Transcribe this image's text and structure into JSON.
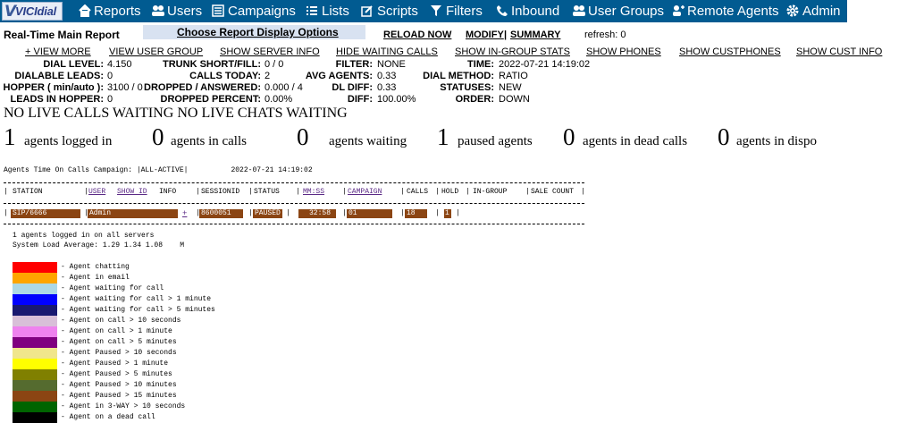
{
  "nav": {
    "logo": "VICIdial",
    "items": [
      "Reports",
      "Users",
      "Campaigns",
      "Lists",
      "Scripts",
      "Filters",
      "Inbound",
      "User Groups",
      "Remote Agents",
      "Admin"
    ],
    "bg_color": "#015b91"
  },
  "header": {
    "title": "Real-Time Main Report",
    "choose_options": "Choose Report Display Options",
    "reload": "RELOAD NOW",
    "modify": "MODIFY",
    "sep": "|",
    "summary": "SUMMARY",
    "refresh": "refresh: 0"
  },
  "view_links": [
    "+ VIEW MORE",
    "VIEW USER GROUP",
    "SHOW SERVER INFO",
    "HIDE WAITING CALLS",
    "SHOW IN-GROUP STATS",
    "SHOW PHONES",
    "SHOW CUSTPHONES",
    "SHOW CUST INFO"
  ],
  "stats": {
    "col1": [
      {
        "label": "DIAL LEVEL:",
        "value": "4.150"
      },
      {
        "label": "DIALABLE LEADS:",
        "value": "0"
      },
      {
        "label": "HOPPER ( min/auto ):",
        "value": "3100 / 0"
      },
      {
        "label": "LEADS IN HOPPER:",
        "value": "0"
      }
    ],
    "col2": [
      {
        "label": "TRUNK SHORT/FILL:",
        "value": "0 / 0"
      },
      {
        "label": "CALLS TODAY:",
        "value": "2"
      },
      {
        "label": "DROPPED / ANSWERED:",
        "value": "0.000 / 4"
      },
      {
        "label": "DROPPED PERCENT:",
        "value": "0.00%"
      }
    ],
    "col3": [
      {
        "label": "FILTER:",
        "value": "NONE"
      },
      {
        "label": "AVG AGENTS:",
        "value": "0.33"
      },
      {
        "label": "DL DIFF:",
        "value": "0.33"
      },
      {
        "label": "DIFF:",
        "value": "100.00%"
      }
    ],
    "col4": [
      {
        "label": "TIME:",
        "value": "2022-07-21 14:19:02"
      },
      {
        "label": "DIAL METHOD:",
        "value": "RATIO"
      },
      {
        "label": "STATUSES:",
        "value": "NEW"
      },
      {
        "label": "ORDER:",
        "value": "DOWN"
      }
    ]
  },
  "no_live": "NO LIVE CALLS WAITING NO LIVE CHATS WAITING",
  "counts": [
    {
      "num": "1",
      "label": "agents logged in"
    },
    {
      "num": "0",
      "label": "agents in calls"
    },
    {
      "num": "0",
      "label": "agents waiting"
    },
    {
      "num": "1",
      "label": "paused agents"
    },
    {
      "num": "0",
      "label": "agents in dead calls"
    },
    {
      "num": "0",
      "label": "agents in dispo"
    }
  ],
  "report": {
    "title_line": "Agents Time On Calls Campaign: |ALL-ACTIVE|          2022-07-21 14:19:02",
    "headers": {
      "station": "STATION",
      "user": "USER",
      "show_id": "SHOW ID",
      "info": "INFO",
      "sessionid": "SESSIONID",
      "status": "STATUS",
      "mmss": "MM:SS",
      "campaign": "CAMPAIGN",
      "calls": "CALLS",
      "hold": "HOLD",
      "ingroup": "IN-GROUP",
      "sale_count": "SALE COUNT"
    },
    "row": {
      "station": "SIP/6666",
      "user": "Admin",
      "info": "+",
      "sessionid": "8600051",
      "status": "PAUSED",
      "mmss": "32:58",
      "campaign": "01",
      "calls": "18",
      "hold": "1",
      "row_color": "#8b4513"
    },
    "footer1": "1 agents logged in on all servers",
    "footer2": "System Load Average: 1.29 1.34 1.08    M"
  },
  "legend": [
    {
      "color": "#ff0000",
      "label": "- Agent chatting"
    },
    {
      "color": "#ffa500",
      "label": "- Agent in email"
    },
    {
      "color": "#add8e6",
      "label": "- Agent waiting for call"
    },
    {
      "color": "#0000ff",
      "label": "- Agent waiting for call > 1 minute"
    },
    {
      "color": "#191970",
      "label": "- Agent waiting for call > 5 minutes"
    },
    {
      "color": "#d8bfd8",
      "label": "- Agent on call > 10 seconds"
    },
    {
      "color": "#ee82ee",
      "label": "- Agent on call > 1 minute"
    },
    {
      "color": "#800080",
      "label": "- Agent on call > 5 minutes"
    },
    {
      "color": "#f0e68c",
      "label": "- Agent Paused > 10 seconds"
    },
    {
      "color": "#ffff00",
      "label": "- Agent Paused > 1 minute"
    },
    {
      "color": "#808000",
      "label": "- Agent Paused > 5 minutes"
    },
    {
      "color": "#556b2f",
      "label": "- Agent Paused > 10 minutes"
    },
    {
      "color": "#8b4513",
      "label": "- Agent Paused > 15 minutes"
    },
    {
      "color": "#006400",
      "label": "- Agent in 3-WAY > 10 seconds"
    },
    {
      "color": "#000000",
      "label": "- Agent on a dead call"
    }
  ]
}
